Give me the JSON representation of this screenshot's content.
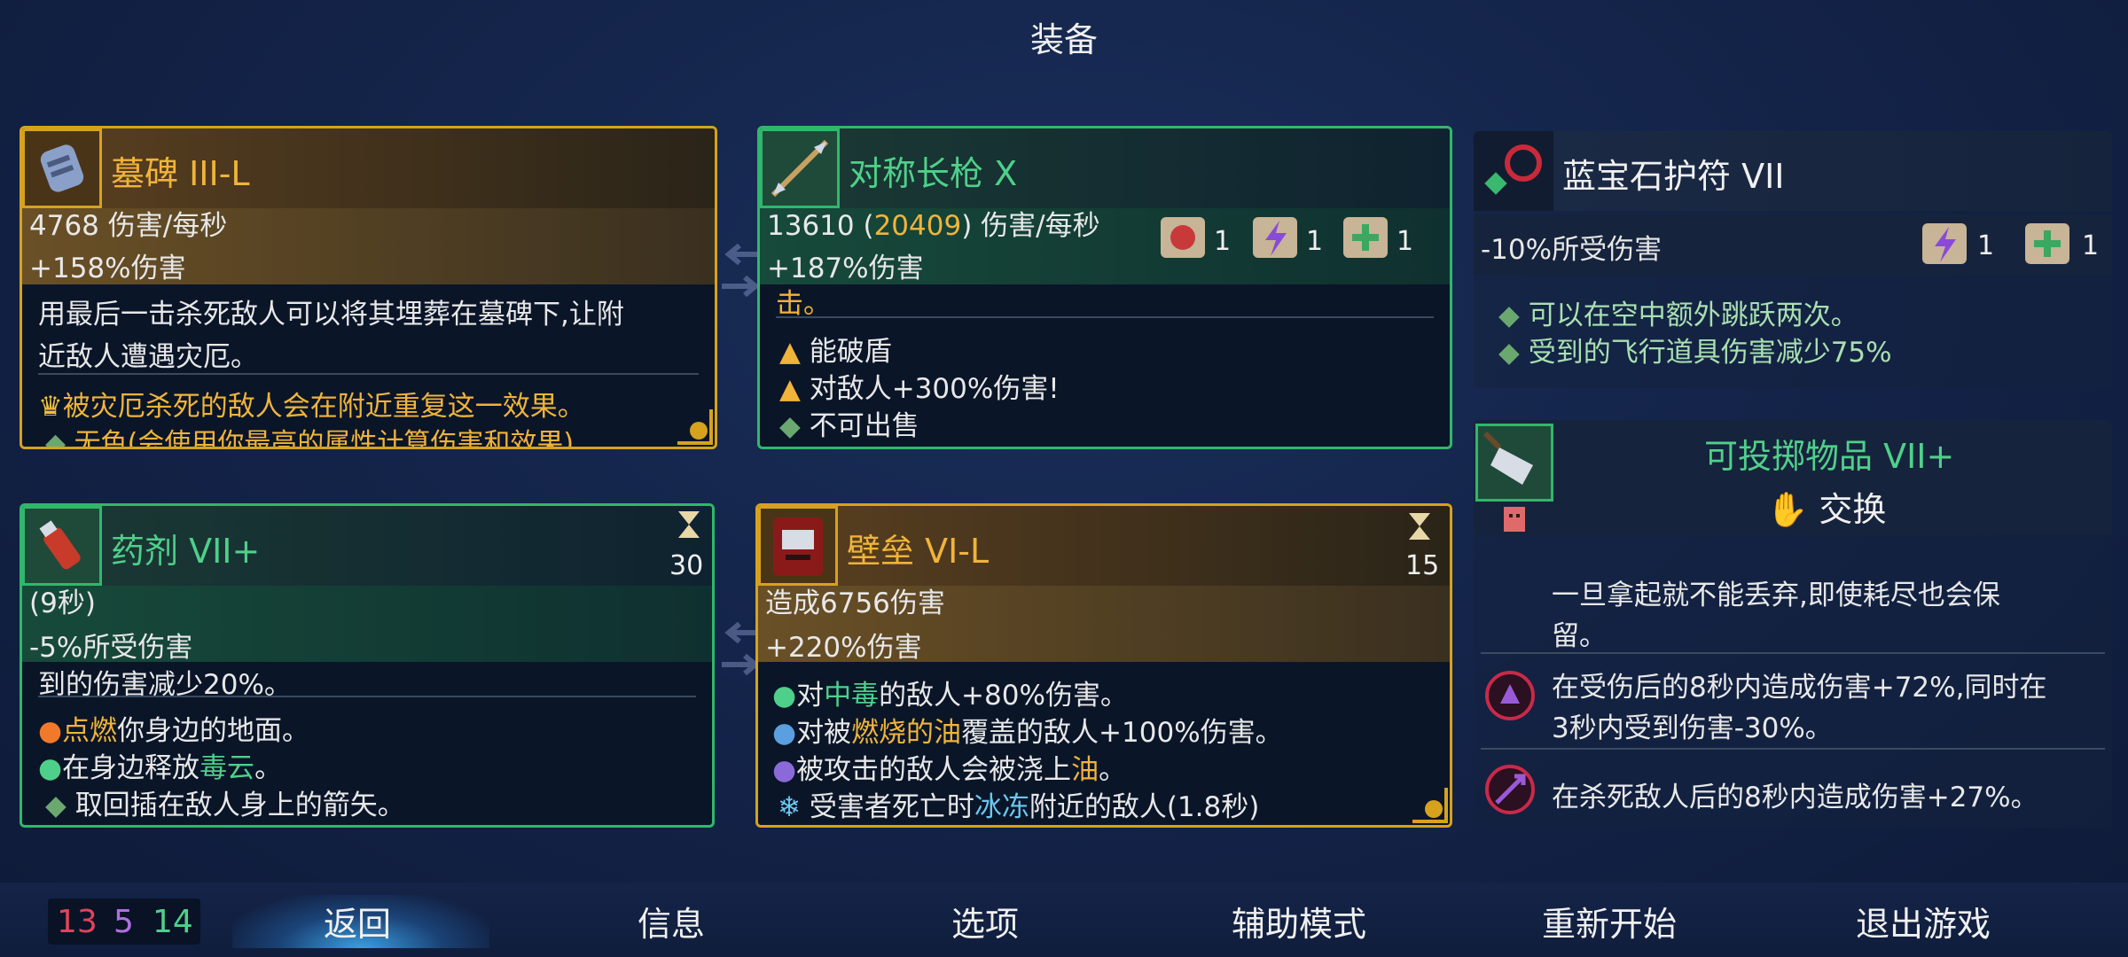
{
  "header": {
    "title": "装备"
  },
  "cards": {
    "tombstone": {
      "name": "墓碑 III-L",
      "stat1": "4768 伤害/每秒",
      "stat2": "+158%伤害",
      "desc1": "用最后一击杀死敌人可以将其埋葬在墓碑下,让附",
      "desc2": "近敌人遭遇灾厄。",
      "perk1": "被灾厄杀死的敌人会在附近重复这一效果。",
      "perk2": "无色(会使用你最高的属性计算伤害和效果)"
    },
    "spear": {
      "name": "对称长枪 X",
      "dps_base": "13610 (",
      "dps_bonus": "20409",
      "dps_suffix": ") 伤害/每秒",
      "stat2": "+187%伤害",
      "line3": "击。",
      "perk1": "能破盾",
      "perk2": "对敌人+300%伤害!",
      "perk3": "不可出售",
      "scroll_counts": [
        "1",
        "1",
        "1"
      ]
    },
    "amulet": {
      "name": "蓝宝石护符 VII",
      "stat1": "-10%所受伤害",
      "perk1": "可以在空中额外跳跃两次。",
      "perk2": "受到的飞行道具伤害减少75%",
      "scroll_counts": [
        "1",
        "1"
      ]
    },
    "throwable": {
      "name": "可投掷物品 VII+",
      "swap_label": "交换",
      "line1": "一旦拿起就不能丢弃,即使耗尽也会保",
      "line2": "留。",
      "line3": "在受伤后的8秒内造成伤害+72%,同时在",
      "line4": "3秒内受到伤害-30%。",
      "line5": "在杀死敌人后的8秒内造成伤害+27%。"
    },
    "potion": {
      "name": "药剂 VII+",
      "cooldown": "30",
      "stat1": "(9秒)",
      "stat2": "-5%所受伤害",
      "line3": "到的伤害减少20%。",
      "perk1_a": "点燃",
      "perk1_b": "你身边的地面。",
      "perk2_a": "在身边释放",
      "perk2_b": "毒云",
      "perk2_c": "。",
      "perk3": "取回插在敌人身上的箭矢。"
    },
    "rampart": {
      "name": "壁垒 VI-L",
      "cooldown": "15",
      "stat1": "造成6756伤害",
      "stat2": "+220%伤害",
      "perk1_a": "对",
      "perk1_b": "中毒",
      "perk1_c": "的敌人+80%伤害。",
      "perk2_a": "对被",
      "perk2_b": "燃烧的油",
      "perk2_c": "覆盖的敌人+100%伤害。",
      "perk3_a": "被攻击的敌人会被浇上",
      "perk3_b": "油",
      "perk3_c": "。",
      "perk4_a": "受害者死亡时",
      "perk4_b": "冰冻",
      "perk4_c": "附近的敌人(1.8秒)"
    }
  },
  "scrolls": {
    "brutality": "13",
    "tactics": "5",
    "survival": "14"
  },
  "menu": {
    "back": "返回",
    "info": "信息",
    "options": "选项",
    "assist": "辅助模式",
    "restart": "重新开始",
    "quit": "退出游戏"
  },
  "colors": {
    "brutality": "#e0445a",
    "tactics": "#b070e0",
    "survival": "#4fd08a",
    "gold": "#f0b43a",
    "legendary_border": "#d6a21e",
    "card_border": "#2fb86b"
  }
}
